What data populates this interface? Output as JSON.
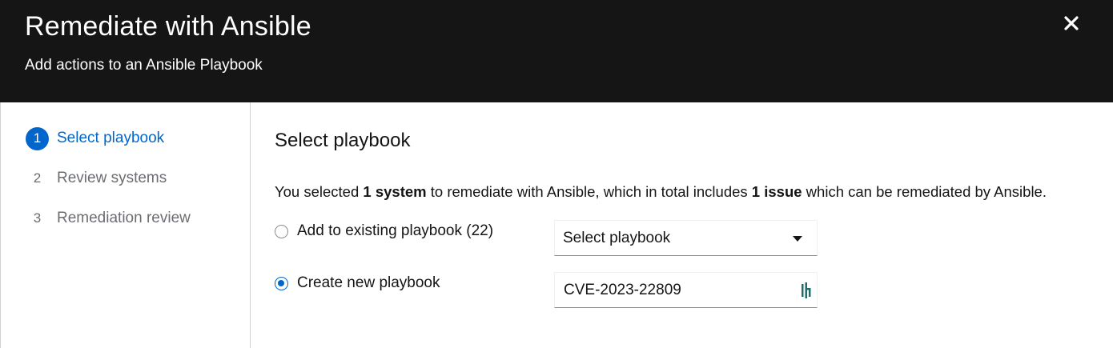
{
  "header": {
    "title": "Remediate with Ansible",
    "description": "Add actions to an Ansible Playbook"
  },
  "nav": {
    "steps": [
      {
        "number": "1",
        "label": "Select playbook",
        "active": true
      },
      {
        "number": "2",
        "label": "Review systems",
        "active": false
      },
      {
        "number": "3",
        "label": "Remediation review",
        "active": false
      }
    ]
  },
  "main": {
    "title": "Select playbook",
    "summary": {
      "prefix": "You selected ",
      "systems": "1 system",
      "middle": " to remediate with Ansible, which in total includes ",
      "issues": "1 issue",
      "suffix": " which can be remediated by Ansible."
    },
    "options": {
      "existing_label": "Add to existing playbook (22)",
      "existing_checked": false,
      "new_label": "Create new playbook",
      "new_checked": true
    },
    "select": {
      "value": "Select playbook"
    },
    "name_input": {
      "value": "CVE-2023-22809"
    }
  },
  "icons": {
    "close": "close-icon",
    "caret": "caret-down-icon",
    "password_manager": "password-manager-icon"
  },
  "colors": {
    "header_bg": "#151515",
    "accent": "#0066cc",
    "muted": "#6a6e73"
  }
}
